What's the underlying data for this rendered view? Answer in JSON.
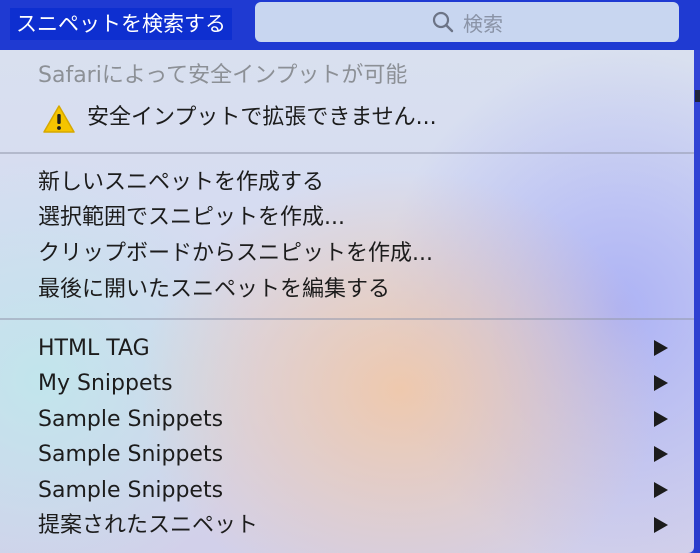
{
  "topbar": {
    "title": "スニペットを検索する",
    "search_placeholder": "検索"
  },
  "menu": {
    "header_items": [
      {
        "label": "Safariによって安全インプットが可能",
        "disabled": true
      },
      {
        "label": "安全インプットで拡張できません...",
        "icon": "warning-icon"
      }
    ],
    "actions": [
      {
        "label": "新しいスニペットを作成する"
      },
      {
        "label": "選択範囲でスニピットを作成..."
      },
      {
        "label": "クリップボードからスニピットを作成..."
      },
      {
        "label": "最後に開いたスニペットを編集する"
      }
    ],
    "submenus": [
      {
        "label": "HTML TAG"
      },
      {
        "label": "My Snippets"
      },
      {
        "label": "Sample Snippets"
      },
      {
        "label": "Sample Snippets"
      },
      {
        "label": "Sample Snippets"
      },
      {
        "label": "提案されたスニペット"
      }
    ]
  },
  "colors": {
    "accent_blue": "#1f3ad2",
    "selected_title_bg": "#0e2fd0",
    "warning_yellow": "#f5c400"
  }
}
